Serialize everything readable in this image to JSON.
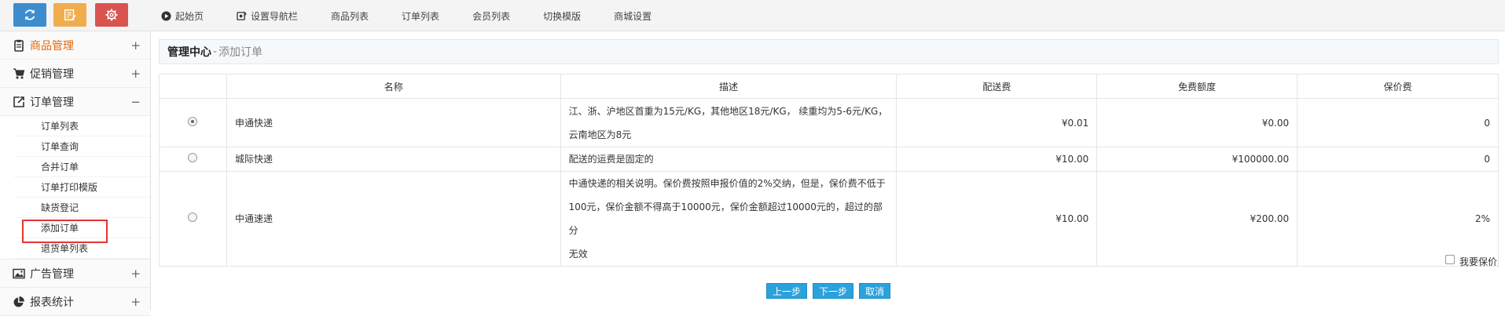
{
  "topbar": {
    "nav": [
      {
        "label": "起始页",
        "icon": "play-circle-icon"
      },
      {
        "label": "设置导航栏",
        "icon": "settings-edit-icon"
      },
      {
        "label": "商品列表"
      },
      {
        "label": "订单列表"
      },
      {
        "label": "会员列表"
      },
      {
        "label": "切换模版"
      },
      {
        "label": "商城设置"
      }
    ],
    "colors": {
      "refresh": "#3d8ccd",
      "note": "#f0ad4e",
      "gear": "#d9534f"
    }
  },
  "sidebar": {
    "groups": [
      {
        "label": "商品管理",
        "toggle": "+",
        "icon": "clipboard-icon",
        "active": true
      },
      {
        "label": "促销管理",
        "toggle": "+",
        "icon": "cart-icon"
      },
      {
        "label": "订单管理",
        "toggle": "−",
        "icon": "external-edit-icon"
      },
      {
        "label": "广告管理",
        "toggle": "+",
        "icon": "image-icon"
      },
      {
        "label": "报表统计",
        "toggle": "+",
        "icon": "pie-chart-icon"
      }
    ],
    "order_items": [
      "订单列表",
      "订单查询",
      "合并订单",
      "订单打印模版",
      "缺货登记",
      "添加订单",
      "退货单列表"
    ],
    "highlight_item": "添加订单",
    "accent_color": "#e8660b"
  },
  "breadcrumb": {
    "main": "管理中心",
    "sep": "-",
    "sub": "添加订单"
  },
  "table": {
    "headers": [
      "名称",
      "描述",
      "配送费",
      "免费额度",
      "保价费"
    ],
    "rows": [
      {
        "selected": true,
        "name": "申通快递",
        "desc_lines": [
          "江、浙、沪地区首重为15元/KG，其他地区18元/KG， 续重均为5-6元/KG，",
          "云南地区为8元"
        ],
        "fee": "¥0.01",
        "free": "¥0.00",
        "insure": "0"
      },
      {
        "selected": false,
        "name": "城际快递",
        "desc_lines": [
          "配送的运费是固定的"
        ],
        "fee": "¥10.00",
        "free": "¥100000.00",
        "insure": "0"
      },
      {
        "selected": false,
        "name": "中通速递",
        "desc_lines": [
          "中通快递的相关说明。保价费按照申报价值的2%交纳，但是，保价费不低于",
          "100元，保价金额不得高于10000元，保价金额超过10000元的，超过的部分",
          "无效"
        ],
        "fee": "¥10.00",
        "free": "¥200.00",
        "insure": "2%"
      }
    ]
  },
  "insure_checkbox": {
    "label": "我要保价",
    "checked": false
  },
  "buttons": {
    "prev": "上一步",
    "next": "下一步",
    "cancel": "取消"
  }
}
